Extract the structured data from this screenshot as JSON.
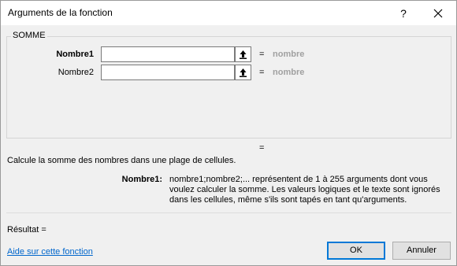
{
  "window": {
    "title": "Arguments de la fonction",
    "help_glyph": "?",
    "close_icon": "close-icon"
  },
  "function_group": {
    "name": "SOMME",
    "arguments": [
      {
        "label": "Nombre1",
        "bold": true,
        "value": "",
        "equals": "=",
        "type_hint": "nombre"
      },
      {
        "label": "Nombre2",
        "bold": false,
        "value": "",
        "equals": "=",
        "type_hint": "nombre"
      }
    ]
  },
  "result_preview": {
    "equals": "="
  },
  "description": "Calcule la somme des nombres dans une plage de cellules.",
  "parameter_help": {
    "name": "Nombre1:",
    "text": "nombre1;nombre2;... représentent de 1 à 255 arguments dont vous voulez calculer la somme. Les valeurs logiques et le texte sont ignorés dans les cellules, même s'ils sont tapés en tant qu'arguments."
  },
  "formula_result": "Résultat =",
  "help_link": "Aide sur cette fonction",
  "buttons": {
    "ok": "OK",
    "cancel": "Annuler"
  },
  "colors": {
    "accent": "#0078d7",
    "link": "#0066cc",
    "hint": "#a0a0a0"
  }
}
